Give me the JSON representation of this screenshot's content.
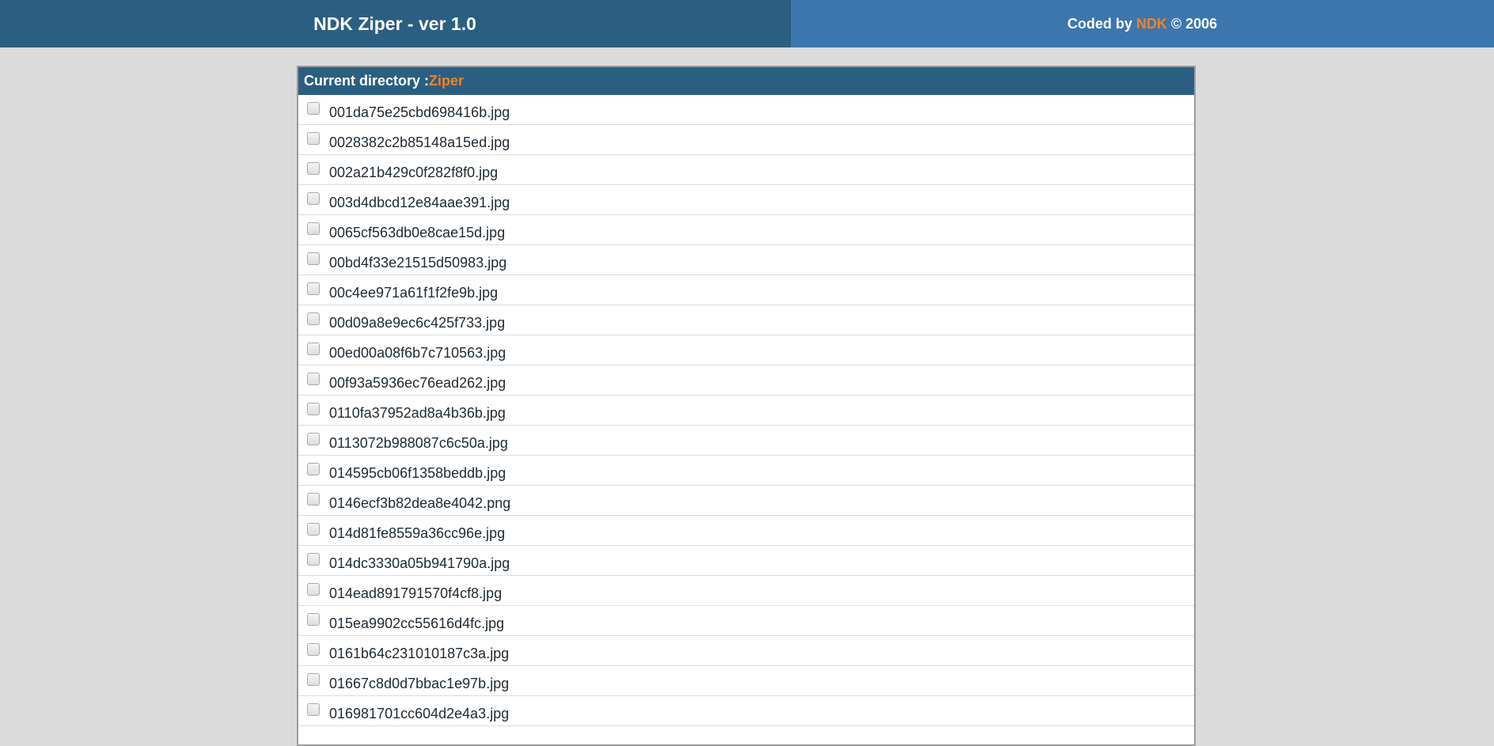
{
  "header": {
    "title": "NDK Ziper - ver 1.0",
    "credit_prefix": "Coded by ",
    "credit_author": "NDK",
    "credit_suffix": " © 2006"
  },
  "directory": {
    "label": "Current directory : ",
    "name": "Ziper"
  },
  "files": [
    "001da75e25cbd698416b.jpg",
    "0028382c2b85148a15ed.jpg",
    "002a21b429c0f282f8f0.jpg",
    "003d4dbcd12e84aae391.jpg",
    "0065cf563db0e8cae15d.jpg",
    "00bd4f33e21515d50983.jpg",
    "00c4ee971a61f1f2fe9b.jpg",
    "00d09a8e9ec6c425f733.jpg",
    "00ed00a08f6b7c710563.jpg",
    "00f93a5936ec76ead262.jpg",
    "0110fa37952ad8a4b36b.jpg",
    "0113072b988087c6c50a.jpg",
    "014595cb06f1358beddb.jpg",
    "0146ecf3b82dea8e4042.png",
    "014d81fe8559a36cc96e.jpg",
    "014dc3330a05b941790a.jpg",
    "014ead891791570f4cf8.jpg",
    "015ea9902cc55616d4fc.jpg",
    "0161b64c231010187c3a.jpg",
    "01667c8d0d7bbac1e97b.jpg",
    "016981701cc604d2e4a3.jpg"
  ],
  "colors": {
    "header_dark": "#2b5f82",
    "header_light": "#3d76ad",
    "accent": "#f58220",
    "background": "#dbdbdb"
  }
}
